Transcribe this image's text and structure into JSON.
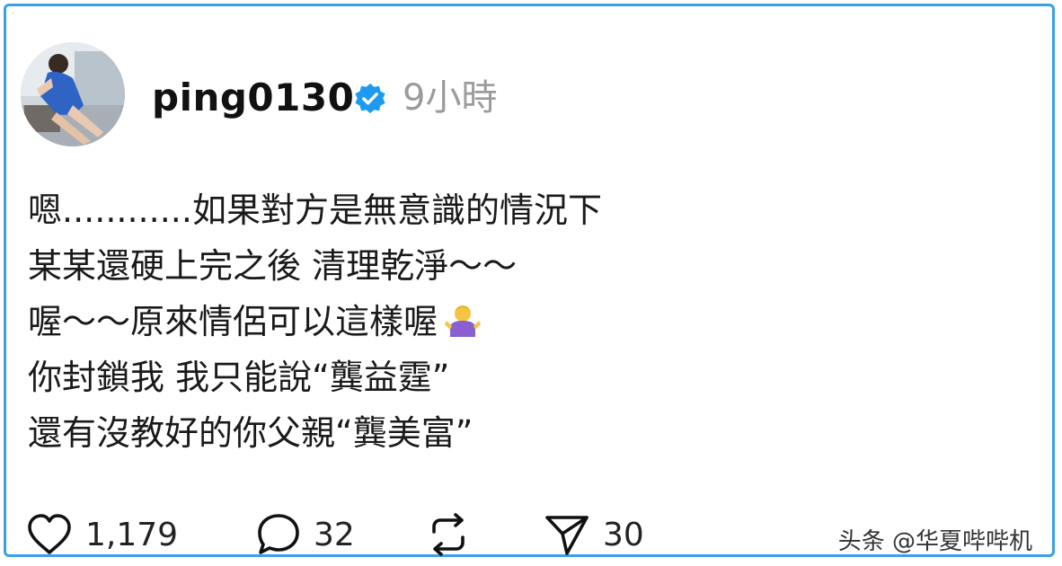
{
  "header": {
    "username": "ping0130",
    "time": "9小時",
    "avatar_icon": "user-avatar-photo",
    "verified_icon": "verified-badge-icon",
    "verified_color": "#1d9bf0"
  },
  "post": {
    "lines": [
      "嗯............如果對方是無意識的情況下",
      "某某還硬上完之後 清理乾淨～～",
      "喔～～原來情侶可以這樣喔",
      "你封鎖我 我只能說“龔益霆”",
      "還有沒教好的你父親“龔美富”"
    ],
    "emoji_icon": "person-shrugging-emoji"
  },
  "actions": {
    "likes": "1,179",
    "comments": "32",
    "reposts": "",
    "shares": "30",
    "like_icon": "heart-icon",
    "comment_icon": "comment-bubble-icon",
    "repost_icon": "repost-icon",
    "share_icon": "send-icon"
  },
  "watermark": "头条 @华夏哔哔机",
  "frame_color": "#3aa0e8"
}
